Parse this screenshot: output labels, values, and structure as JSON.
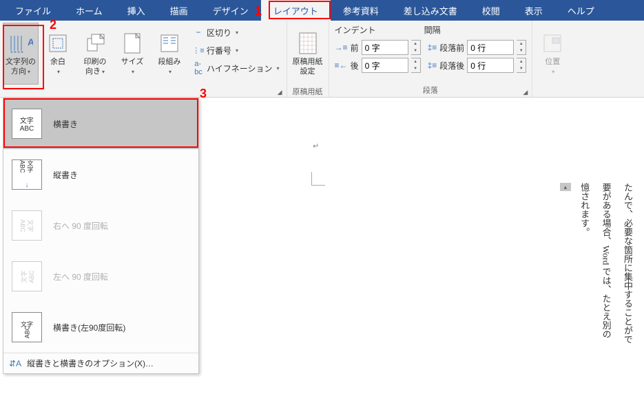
{
  "tabs": {
    "file": "ファイル",
    "home": "ホーム",
    "insert": "挿入",
    "draw": "描画",
    "design": "デザイン",
    "layout": "レイアウト",
    "references": "参考資料",
    "mailings": "差し込み文書",
    "review": "校閲",
    "view": "表示",
    "help": "ヘルプ"
  },
  "ribbon": {
    "text_direction": "文字列の\n方向",
    "margins": "余白",
    "orientation": "印刷の\n向き",
    "size": "サイズ",
    "columns": "段組み",
    "breaks": "区切り",
    "line_numbers": "行番号",
    "hyphenation": "ハイフネーション",
    "genkou_label": "原稿用紙\n設定",
    "genkou_group": "原稿用紙",
    "indent_header": "インデント",
    "spacing_header": "間隔",
    "indent_before": "前",
    "indent_after": "後",
    "indent_before_val": "0 字",
    "indent_after_val": "0 字",
    "spacing_before": "段落前",
    "spacing_after": "段落後",
    "spacing_before_val": "0 行",
    "spacing_after_val": "0 行",
    "paragraph_group": "段落",
    "position": "位置"
  },
  "dropdown": {
    "horizontal": "横書き",
    "vertical": "縦書き",
    "rotate_right": "右へ 90 度回転",
    "rotate_left": "左へ 90 度回転",
    "horizontal_left90": "横書き(左90度回転)",
    "options": "縦書きと横書きのオプション(X)…",
    "icon_text": "文字\nABC",
    "icon_text_v": "文字\nABC"
  },
  "callouts": {
    "c1": "1",
    "c2": "2",
    "c3": "3"
  },
  "document": {
    "line1": "たんで、必要な箇所に集中することがで",
    "line2": "要がある場合、Word では、たとえ別の",
    "line3": "憶されます。"
  }
}
